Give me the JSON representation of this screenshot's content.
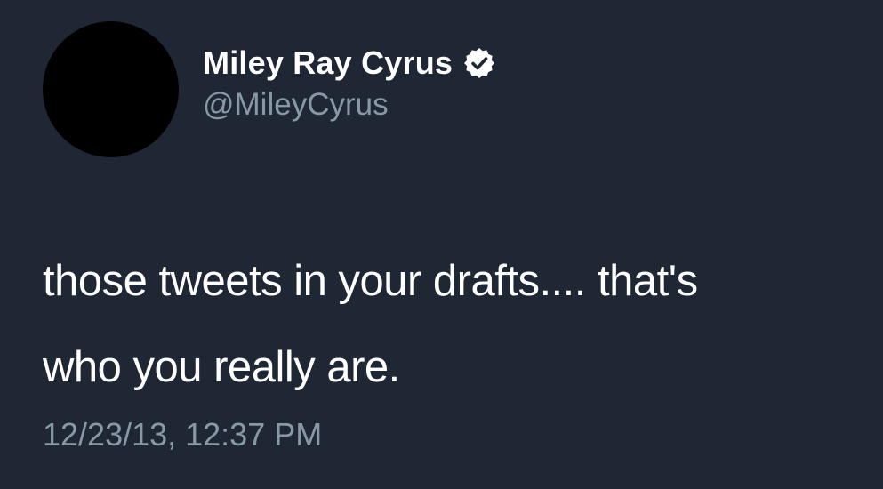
{
  "tweet": {
    "display_name": "Miley Ray Cyrus",
    "handle": "@MileyCyrus",
    "verified": true,
    "text_line1": "those tweets in your drafts.... that's",
    "text_line2": "who you really are.",
    "timestamp": "12/23/13, 12:37 PM"
  },
  "colors": {
    "background": "#1f2735",
    "primary_text": "#ffffff",
    "secondary_text": "#8899a6",
    "avatar": "#000000"
  },
  "icons": {
    "verified": "verified-badge-icon"
  }
}
